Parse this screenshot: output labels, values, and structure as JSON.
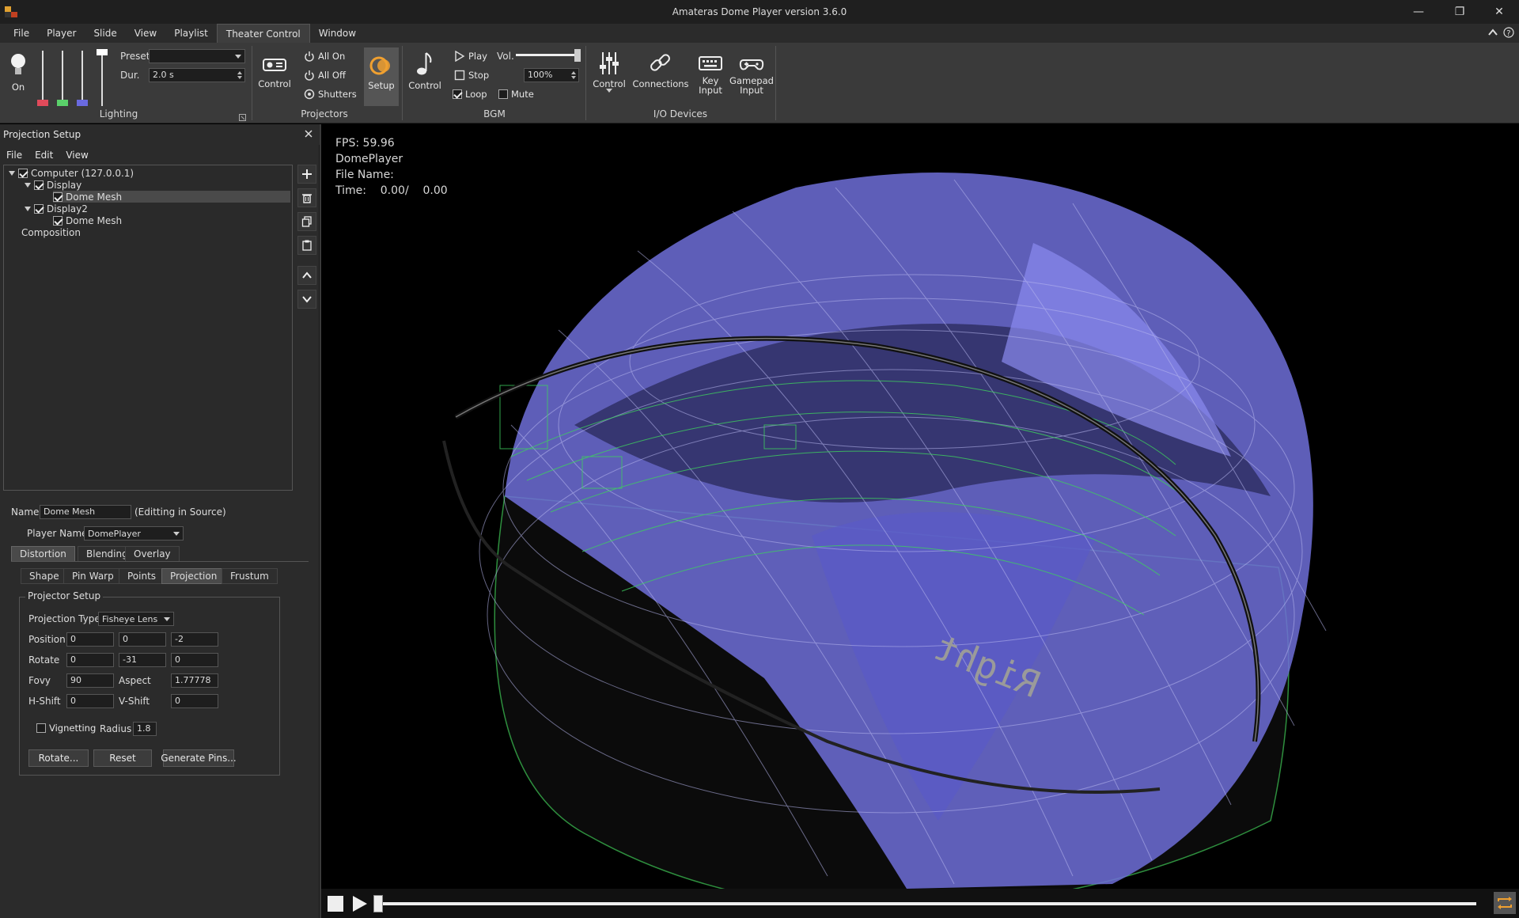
{
  "window": {
    "title": "Amateras Dome Player version 3.6.0",
    "minimize": "—",
    "restore": "❐",
    "close": "✕"
  },
  "menubar": {
    "items": [
      "File",
      "Player",
      "Slide",
      "View",
      "Playlist",
      "Theater Control",
      "Window"
    ],
    "active": "Theater Control"
  },
  "ribbon": {
    "lighting": {
      "on_label": "On",
      "preset_label": "Preset",
      "preset_value": "",
      "dur_label": "Dur.",
      "dur_value": "2.0 s",
      "group_label": "Lighting",
      "slider_colors": [
        "#e04a5a",
        "#5ad06a",
        "#6a6ae0",
        "#ffffff"
      ]
    },
    "projectors": {
      "control_label": "Control",
      "all_on": "All On",
      "all_off": "All Off",
      "shutters": "Shutters",
      "setup_label": "Setup",
      "group_label": "Projectors"
    },
    "bgm": {
      "control_label": "Control",
      "play": "Play",
      "stop": "Stop",
      "loop": "Loop",
      "loop_checked": true,
      "mute": "Mute",
      "mute_checked": false,
      "vol_label": "Vol.",
      "vol_value": "100%",
      "group_label": "BGM"
    },
    "io": {
      "control_label": "Control",
      "connections_label": "Connections",
      "key_input_label": "Key\nInput",
      "gamepad_input_label": "Gamepad\nInput",
      "group_label": "I/O Devices"
    }
  },
  "panel": {
    "title": "Projection Setup",
    "menu": [
      "File",
      "Edit",
      "View"
    ],
    "tree": {
      "computer": "Computer (127.0.0.1)",
      "display1": "Display",
      "dome1": "Dome Mesh",
      "display2": "Display2",
      "dome2": "Dome Mesh",
      "composition": "Composition"
    },
    "name_label": "Name",
    "name_value": "Dome Mesh",
    "name_note": "(Editting in Source)",
    "player_name_label": "Player Name",
    "player_name_value": "DomePlayer",
    "tabs1": [
      "Distortion",
      "Blending",
      "Overlay"
    ],
    "tabs2": [
      "Shape",
      "Pin Warp",
      "Points",
      "Projection",
      "Frustum"
    ],
    "groupbox": "Projector Setup",
    "projection_type_label": "Projection Type",
    "projection_type_value": "Fisheye Lens",
    "position_label": "Position",
    "position": [
      "0",
      "0",
      "-2"
    ],
    "rotate_label": "Rotate",
    "rotate": [
      "0",
      "-31",
      "0"
    ],
    "fovy_label": "Fovy",
    "fovy": "90",
    "aspect_label": "Aspect",
    "aspect": "1.77778",
    "hshift_label": "H-Shift",
    "hshift": "0",
    "vshift_label": "V-Shift",
    "vshift": "0",
    "vignetting_label": "Vignetting",
    "radius_label": "Radius",
    "radius": "1.8",
    "rotate_btn": "Rotate...",
    "reset_btn": "Reset",
    "generate_btn": "Generate Pins..."
  },
  "hud": {
    "fps": "FPS: 59.96",
    "player": "DomePlayer",
    "file_name": "File Name:",
    "time": "Time:    0.00/    0.00",
    "dome_label": "Right"
  },
  "colors": {
    "accent": "#f0a030",
    "dome": "#7a7ae6",
    "wire": "#3ecf5e"
  }
}
